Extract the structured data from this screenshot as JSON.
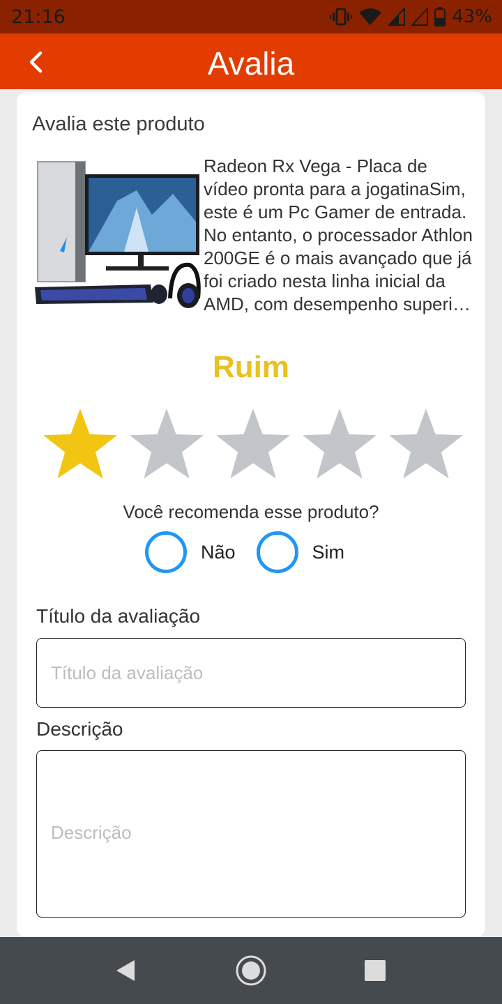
{
  "status_bar": {
    "time": "21:16",
    "battery_percent": "43%",
    "icons": [
      "vibrate-icon",
      "wifi-icon",
      "signal-icon",
      "signal-empty-icon",
      "battery-icon"
    ]
  },
  "app_bar": {
    "title": "Avalia",
    "back_icon": "chevron-left-icon"
  },
  "review": {
    "section_title": "Avalia este produto",
    "product": {
      "image": "gaming-pc-image",
      "description": "Radeon Rx Vega - Placa de vídeo pronta para a jogatinaSim, este é um Pc Gamer de entrada. No entanto, o processador Athlon 200GE é o mais avançado que já foi criado nesta linha inicial da AMD, com desempenho superior ao dos antecessores."
    },
    "rating_label": "Ruim",
    "rating": {
      "value": 1,
      "max": 5
    },
    "recommend": {
      "question": "Você recomenda esse produto?",
      "options": [
        "Não",
        "Sim"
      ],
      "selected": null
    },
    "title_field": {
      "label": "Título da avaliação",
      "placeholder": "Título da avaliação",
      "value": ""
    },
    "description_field": {
      "label": "Descrição",
      "placeholder": "Descrição",
      "value": ""
    }
  },
  "nav_bar": {
    "buttons": [
      "back-triangle-icon",
      "home-circle-icon",
      "recents-square-icon"
    ]
  },
  "colors": {
    "status_bar": "#8a2200",
    "app_bar": "#e23c00",
    "star_filled": "#f2c512",
    "star_empty": "#c2c5c9",
    "rating_label": "#e9c120",
    "radio": "#2196f3",
    "nav_bar": "#454a4f"
  }
}
